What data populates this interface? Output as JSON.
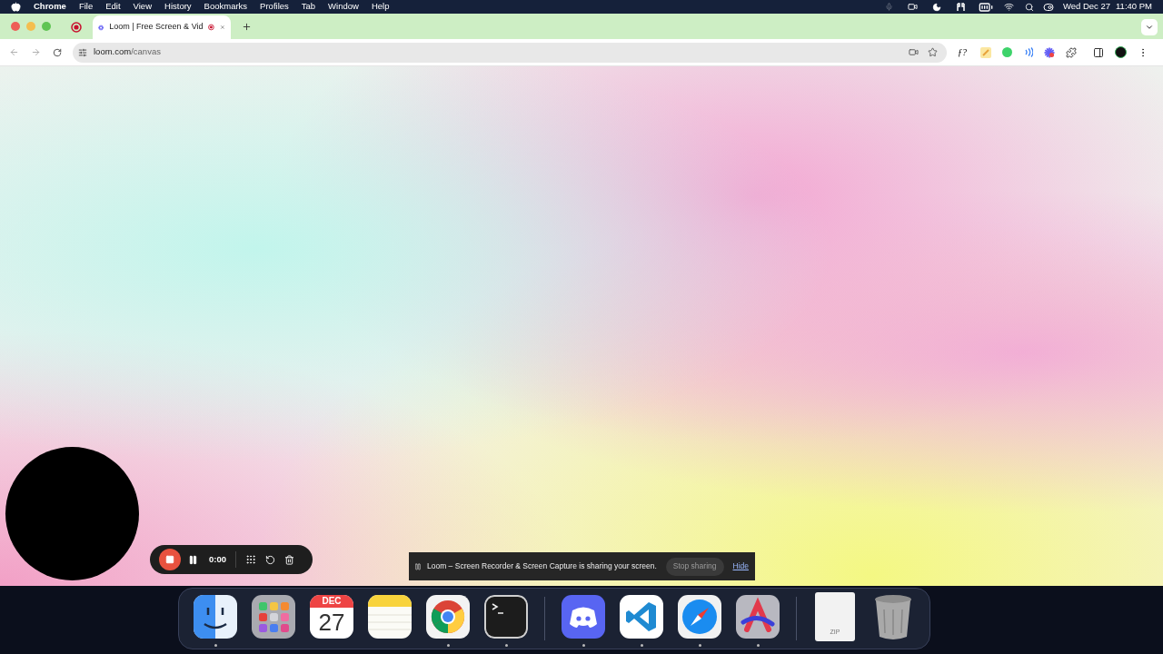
{
  "menu_bar": {
    "app": "Chrome",
    "menus": [
      "File",
      "Edit",
      "View",
      "History",
      "Bookmarks",
      "Profiles",
      "Tab",
      "Window",
      "Help"
    ],
    "date": "Wed Dec 27",
    "time": "11:40 PM"
  },
  "tabs": [
    {
      "kind": "pinned",
      "selected": false,
      "recording": true
    },
    {
      "kind": "page",
      "title": "Loom | Free Screen & Vid",
      "selected": true,
      "recording": true
    }
  ],
  "address_bar": {
    "host": "loom.com",
    "path": "/canvas"
  },
  "extensions": {
    "formula_label": "ƒ?"
  },
  "recorder": {
    "time": "0:00"
  },
  "share_bar": {
    "message": "Loom – Screen Recorder & Screen Capture is sharing your screen.",
    "stop_label": "Stop sharing",
    "hide_label": "Hide"
  },
  "dock": {
    "groups": [
      {
        "items": [
          {
            "kind": "finder",
            "running": true
          },
          {
            "kind": "launchpad",
            "running": false
          },
          {
            "kind": "calendar",
            "month": "DEC",
            "day": "27",
            "running": false
          },
          {
            "kind": "notes",
            "running": false
          },
          {
            "kind": "chrome",
            "running": true
          },
          {
            "kind": "terminal",
            "running": true
          }
        ]
      },
      {
        "items": [
          {
            "kind": "discord",
            "running": true
          },
          {
            "kind": "vscode",
            "running": true
          },
          {
            "kind": "safari",
            "running": true
          },
          {
            "kind": "arc",
            "running": true
          }
        ]
      },
      {
        "items": [
          {
            "kind": "zip",
            "label": "ZIP",
            "running": false
          },
          {
            "kind": "trash",
            "running": false
          }
        ]
      }
    ]
  }
}
